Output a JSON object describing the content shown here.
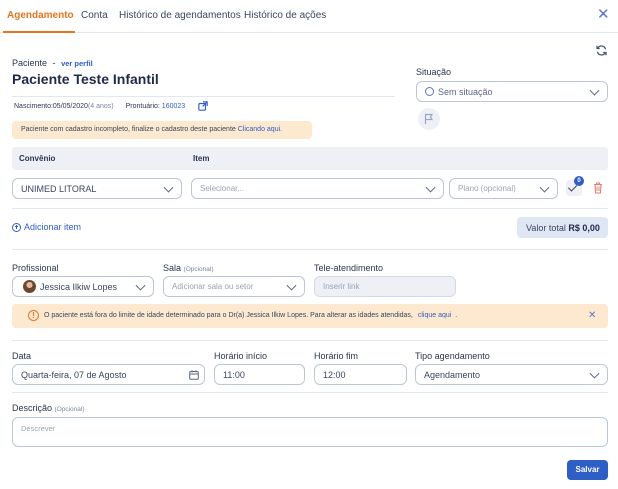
{
  "tabs": [
    {
      "label": "Agendamento"
    },
    {
      "label": "Conta"
    },
    {
      "label": "Histórico de agendamentos"
    },
    {
      "label": "Histórico de ações"
    }
  ],
  "patient": {
    "label": "Paciente",
    "dash": "-",
    "profile_link": "ver perfil",
    "name": "Paciente Teste Infantil",
    "birth_label": "Nascimento:",
    "birth_date": "05/05/2020",
    "age": "(4 anos)",
    "record_label": "Prontuário:",
    "record_number": "160023"
  },
  "status": {
    "label": "Situação",
    "value": "Sem situação"
  },
  "incomplete_warning": {
    "text": "Paciente com cadastro incompleto, finalize o cadastro deste paciente ",
    "link": "Clicando aqui."
  },
  "items_table": {
    "col_convenio": "Convênio",
    "col_item": "Item",
    "convenio_value": "UNIMED LITORAL",
    "item_placeholder": "Selecionar...",
    "plan_placeholder": "Plano (opcional)",
    "badge_count": "0"
  },
  "add_item": "Adicionar item",
  "total": {
    "label": "Valor total",
    "value": "R$ 0,00"
  },
  "professional": {
    "label": "Profissional",
    "value": "Jessica Ilkiw Lopes"
  },
  "room": {
    "label": "Sala",
    "optional": "(Opcional)",
    "placeholder": "Adicionar sala ou setor"
  },
  "tele": {
    "label": "Tele-atendimento",
    "placeholder": "Inserir link"
  },
  "age_warning": {
    "text": "O paciente está fora do limite de idade determinado para o Dr(a) Jessica Ilkiw Lopes. Para alterar as idades atendidas,",
    "link": "clique aqui",
    "tail": "."
  },
  "date": {
    "label": "Data",
    "value": "Quarta-feira, 07 de Agosto"
  },
  "start_time": {
    "label": "Horário início",
    "value": "11:00"
  },
  "end_time": {
    "label": "Horário fim",
    "value": "12:00"
  },
  "schedule_type": {
    "label": "Tipo agendamento",
    "value": "Agendamento"
  },
  "description": {
    "label": "Descrição",
    "optional": "(Opcional)",
    "placeholder": "Descrever"
  },
  "save_label": "Salvar",
  "colors": {
    "accent": "#e4761f",
    "primary": "#2f5ec4",
    "warning_bg": "#fde9cf",
    "danger": "#e67d6b"
  }
}
